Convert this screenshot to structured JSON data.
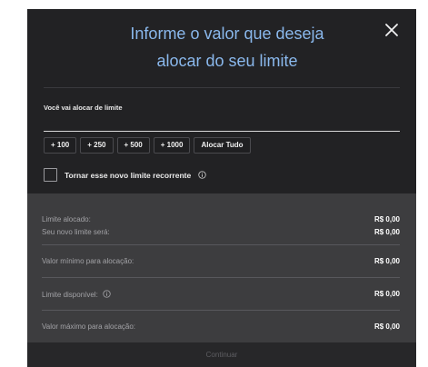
{
  "dialog": {
    "title_line1": "Informe o valor que deseja",
    "title_line2": "alocar do seu limite",
    "close_icon": "close-icon"
  },
  "amount_field": {
    "label": "Você vai alocar de limite",
    "value": ""
  },
  "quick_amounts": [
    "+ 100",
    "+ 250",
    "+ 500",
    "+ 1000",
    "Alocar Tudo"
  ],
  "recurrent": {
    "label": "Tornar esse novo limite recorrente",
    "checked": false,
    "info_icon": "info-icon"
  },
  "summary": {
    "allocated_label": "Limite alocado:",
    "allocated_value": "R$ 0,00",
    "new_limit_label": "Seu novo limite será:",
    "new_limit_value": "R$ 0,00",
    "min_label": "Valor mínimo para alocação:",
    "min_value": "R$ 0,00",
    "available_label": "Limite disponível:",
    "available_value": "R$ 0,00",
    "max_label": "Valor máximo para alocação:",
    "max_value": "R$ 0,00"
  },
  "footer": {
    "continue_label": "Continuar"
  },
  "colors": {
    "modal_bg": "#222224",
    "title": "#8ab8ec",
    "summary_bg": "#3d3d3f",
    "value_text": "#ffffff",
    "muted_text": "#a2a2a6"
  }
}
